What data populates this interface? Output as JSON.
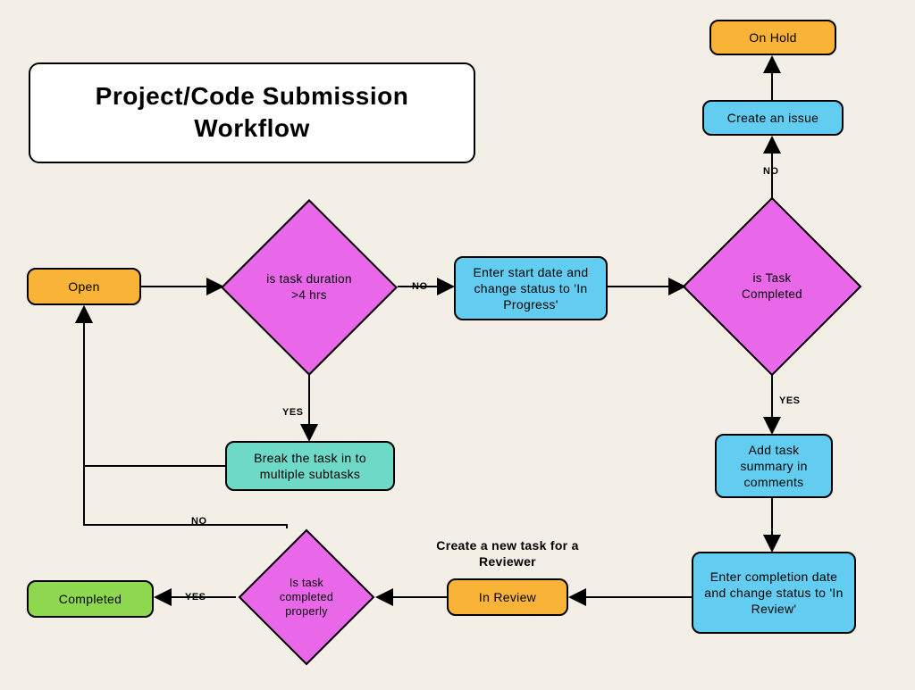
{
  "title": "Project/Code Submission Workflow",
  "nodes": {
    "open": "Open",
    "on_hold": "On Hold",
    "create_issue": "Create an issue",
    "duration_check": "is task duration >4 hrs",
    "enter_start": "Enter start date and change status to 'In Progress'",
    "task_completed_check": "is Task Completed",
    "break_subtasks": "Break the task in to multiple subtasks",
    "add_summary": "Add task summary in comments",
    "enter_completion": "Enter completion date and change status to 'In Review'",
    "in_review": "In Review",
    "completed_properly_check": "Is task completed properly",
    "completed": "Completed"
  },
  "labels": {
    "reviewer_note": "Create a new task for a Reviewer",
    "yes": "YES",
    "no": "NO"
  }
}
